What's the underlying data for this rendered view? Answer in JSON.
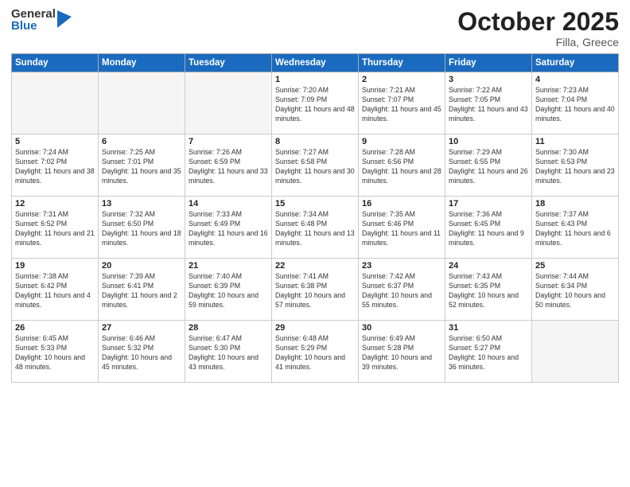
{
  "logo": {
    "general": "General",
    "blue": "Blue"
  },
  "header": {
    "month": "October 2025",
    "location": "Filla, Greece"
  },
  "days_of_week": [
    "Sunday",
    "Monday",
    "Tuesday",
    "Wednesday",
    "Thursday",
    "Friday",
    "Saturday"
  ],
  "weeks": [
    [
      {
        "day": "",
        "info": ""
      },
      {
        "day": "",
        "info": ""
      },
      {
        "day": "",
        "info": ""
      },
      {
        "day": "1",
        "info": "Sunrise: 7:20 AM\nSunset: 7:09 PM\nDaylight: 11 hours and 48 minutes."
      },
      {
        "day": "2",
        "info": "Sunrise: 7:21 AM\nSunset: 7:07 PM\nDaylight: 11 hours and 45 minutes."
      },
      {
        "day": "3",
        "info": "Sunrise: 7:22 AM\nSunset: 7:05 PM\nDaylight: 11 hours and 43 minutes."
      },
      {
        "day": "4",
        "info": "Sunrise: 7:23 AM\nSunset: 7:04 PM\nDaylight: 11 hours and 40 minutes."
      }
    ],
    [
      {
        "day": "5",
        "info": "Sunrise: 7:24 AM\nSunset: 7:02 PM\nDaylight: 11 hours and 38 minutes."
      },
      {
        "day": "6",
        "info": "Sunrise: 7:25 AM\nSunset: 7:01 PM\nDaylight: 11 hours and 35 minutes."
      },
      {
        "day": "7",
        "info": "Sunrise: 7:26 AM\nSunset: 6:59 PM\nDaylight: 11 hours and 33 minutes."
      },
      {
        "day": "8",
        "info": "Sunrise: 7:27 AM\nSunset: 6:58 PM\nDaylight: 11 hours and 30 minutes."
      },
      {
        "day": "9",
        "info": "Sunrise: 7:28 AM\nSunset: 6:56 PM\nDaylight: 11 hours and 28 minutes."
      },
      {
        "day": "10",
        "info": "Sunrise: 7:29 AM\nSunset: 6:55 PM\nDaylight: 11 hours and 26 minutes."
      },
      {
        "day": "11",
        "info": "Sunrise: 7:30 AM\nSunset: 6:53 PM\nDaylight: 11 hours and 23 minutes."
      }
    ],
    [
      {
        "day": "12",
        "info": "Sunrise: 7:31 AM\nSunset: 6:52 PM\nDaylight: 11 hours and 21 minutes."
      },
      {
        "day": "13",
        "info": "Sunrise: 7:32 AM\nSunset: 6:50 PM\nDaylight: 11 hours and 18 minutes."
      },
      {
        "day": "14",
        "info": "Sunrise: 7:33 AM\nSunset: 6:49 PM\nDaylight: 11 hours and 16 minutes."
      },
      {
        "day": "15",
        "info": "Sunrise: 7:34 AM\nSunset: 6:48 PM\nDaylight: 11 hours and 13 minutes."
      },
      {
        "day": "16",
        "info": "Sunrise: 7:35 AM\nSunset: 6:46 PM\nDaylight: 11 hours and 11 minutes."
      },
      {
        "day": "17",
        "info": "Sunrise: 7:36 AM\nSunset: 6:45 PM\nDaylight: 11 hours and 9 minutes."
      },
      {
        "day": "18",
        "info": "Sunrise: 7:37 AM\nSunset: 6:43 PM\nDaylight: 11 hours and 6 minutes."
      }
    ],
    [
      {
        "day": "19",
        "info": "Sunrise: 7:38 AM\nSunset: 6:42 PM\nDaylight: 11 hours and 4 minutes."
      },
      {
        "day": "20",
        "info": "Sunrise: 7:39 AM\nSunset: 6:41 PM\nDaylight: 11 hours and 2 minutes."
      },
      {
        "day": "21",
        "info": "Sunrise: 7:40 AM\nSunset: 6:39 PM\nDaylight: 10 hours and 59 minutes."
      },
      {
        "day": "22",
        "info": "Sunrise: 7:41 AM\nSunset: 6:38 PM\nDaylight: 10 hours and 57 minutes."
      },
      {
        "day": "23",
        "info": "Sunrise: 7:42 AM\nSunset: 6:37 PM\nDaylight: 10 hours and 55 minutes."
      },
      {
        "day": "24",
        "info": "Sunrise: 7:43 AM\nSunset: 6:35 PM\nDaylight: 10 hours and 52 minutes."
      },
      {
        "day": "25",
        "info": "Sunrise: 7:44 AM\nSunset: 6:34 PM\nDaylight: 10 hours and 50 minutes."
      }
    ],
    [
      {
        "day": "26",
        "info": "Sunrise: 6:45 AM\nSunset: 5:33 PM\nDaylight: 10 hours and 48 minutes."
      },
      {
        "day": "27",
        "info": "Sunrise: 6:46 AM\nSunset: 5:32 PM\nDaylight: 10 hours and 45 minutes."
      },
      {
        "day": "28",
        "info": "Sunrise: 6:47 AM\nSunset: 5:30 PM\nDaylight: 10 hours and 43 minutes."
      },
      {
        "day": "29",
        "info": "Sunrise: 6:48 AM\nSunset: 5:29 PM\nDaylight: 10 hours and 41 minutes."
      },
      {
        "day": "30",
        "info": "Sunrise: 6:49 AM\nSunset: 5:28 PM\nDaylight: 10 hours and 39 minutes."
      },
      {
        "day": "31",
        "info": "Sunrise: 6:50 AM\nSunset: 5:27 PM\nDaylight: 10 hours and 36 minutes."
      },
      {
        "day": "",
        "info": ""
      }
    ]
  ]
}
